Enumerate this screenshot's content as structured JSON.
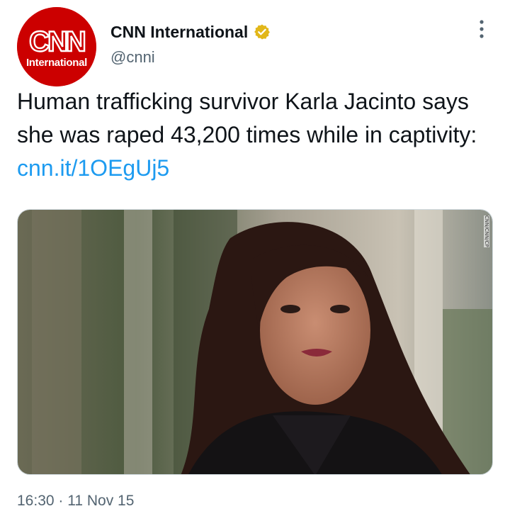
{
  "account": {
    "display_name": "CNN International",
    "handle": "@cnni",
    "avatar_logo_text": "CNN",
    "avatar_sub_text": "International",
    "verified": true
  },
  "tweet": {
    "text": "Human trafficking survivor Karla Jacinto says she was raped 43,200 times while in captivity: ",
    "link_text": "cnn.it/1OEgUj5"
  },
  "media": {
    "credit": "CNN/CNN/CP"
  },
  "meta": {
    "time": "16:30",
    "separator": " · ",
    "date": "11 Nov 15"
  },
  "icons": {
    "verified": "verified-badge-icon",
    "more": "more-options-icon"
  },
  "colors": {
    "brand_red": "#cc0000",
    "link_blue": "#1d9bf0",
    "verified_gold": "#e2b719",
    "secondary_text": "#536471"
  }
}
